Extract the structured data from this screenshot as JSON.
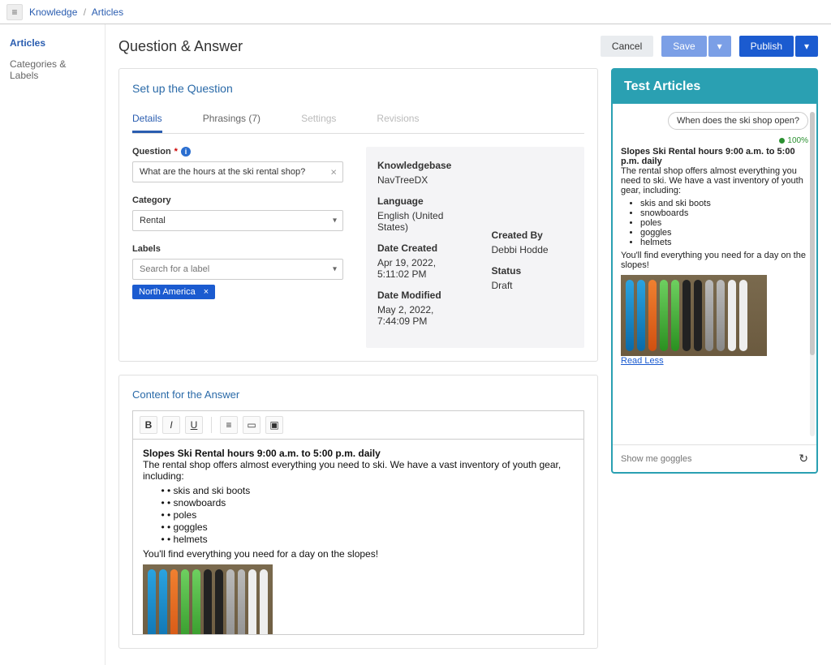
{
  "breadcrumb": {
    "section": "Knowledge",
    "page": "Articles"
  },
  "sidebar": {
    "items": [
      {
        "label": "Articles",
        "active": true
      },
      {
        "label": "Categories & Labels",
        "active": false
      }
    ]
  },
  "header": {
    "title": "Question & Answer",
    "cancel": "Cancel",
    "save": "Save",
    "publish": "Publish"
  },
  "setup": {
    "title": "Set up the Question",
    "tabs": {
      "details": "Details",
      "phrasings": "Phrasings (7)",
      "settings": "Settings",
      "revisions": "Revisions"
    },
    "form": {
      "question_label": "Question",
      "question_value": "What are the hours at the ski rental shop?",
      "category_label": "Category",
      "category_value": "Rental",
      "labels_label": "Labels",
      "labels_placeholder": "Search for a label",
      "chip": "North America"
    },
    "meta": {
      "kb_label": "Knowledgebase",
      "kb_value": "NavTreeDX",
      "lang_label": "Language",
      "lang_value": "English (United States)",
      "created_label": "Date Created",
      "created_value": "Apr 19, 2022, 5:11:02 PM",
      "modified_label": "Date Modified",
      "modified_value": "May 2, 2022, 7:44:09 PM",
      "createdby_label": "Created By",
      "createdby_value": "Debbi Hodde",
      "status_label": "Status",
      "status_value": "Draft"
    }
  },
  "answer": {
    "title": "Content for the Answer",
    "heading": "Slopes  Ski Rental hours 9:00 a.m. to 5:00 p.m. daily",
    "intro": "The rental shop offers almost everything you need to ski. We have a vast inventory of youth gear, including:",
    "items": [
      "skis and ski boots",
      "snowboards",
      "poles",
      "goggles",
      "helmets"
    ],
    "closing": "You'll find everything you need for a day on the slopes!"
  },
  "chat": {
    "header": "Test Articles",
    "user_message": "When does the ski shop open?",
    "confidence": "100%",
    "response_title": "Slopes Ski Rental hours 9:00 a.m. to 5:00 p.m. daily",
    "response_intro": "The rental shop offers almost everything you need to ski. We have a vast inventory of youth gear, including:",
    "response_items": [
      "skis and ski boots",
      "snowboards",
      "poles",
      "goggles",
      "helmets"
    ],
    "response_closing": "You'll find everything you need for a day on the slopes!",
    "read_less": "Read Less",
    "input_placeholder": "Show me goggles"
  }
}
